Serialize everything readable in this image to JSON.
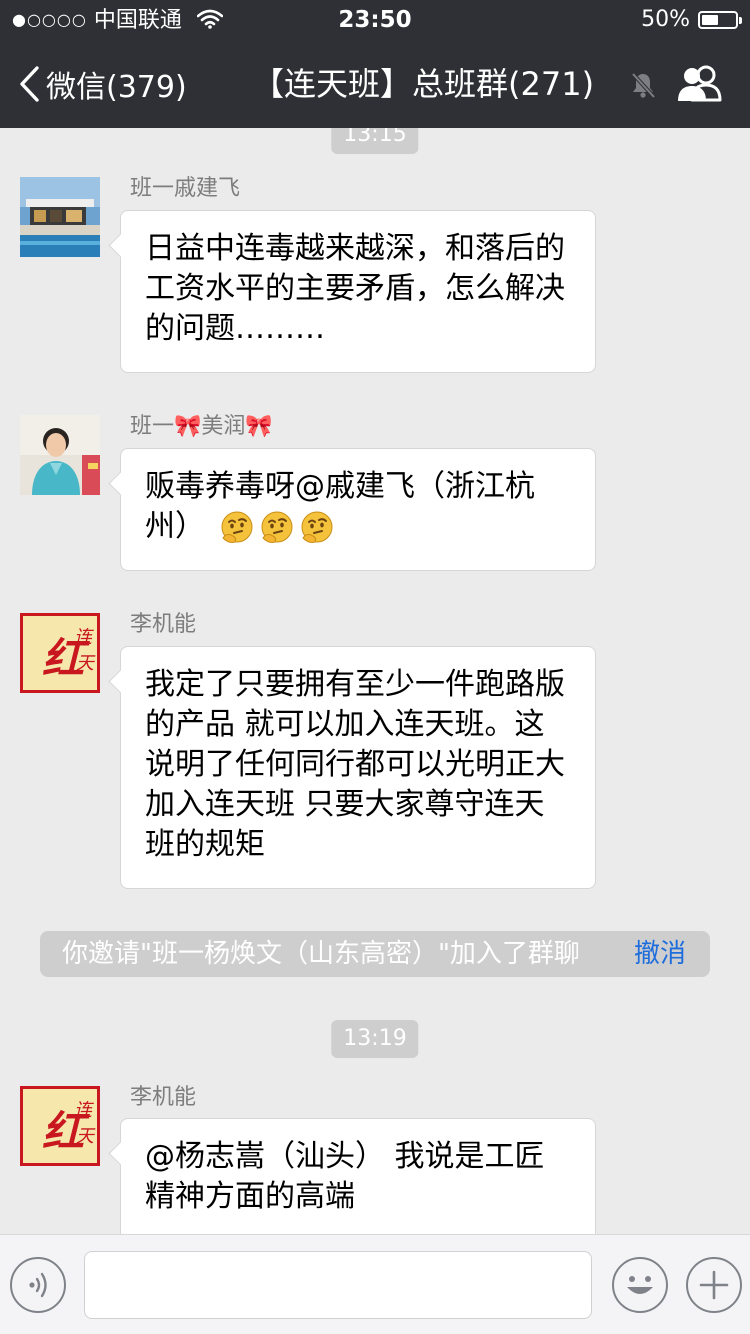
{
  "status_bar": {
    "carrier_dots": "●○○○○",
    "carrier": "中国联通",
    "time": "23:50",
    "battery": "50%",
    "battery_level": 0.5
  },
  "nav": {
    "back_label": "微信(379)",
    "title": "【连天班】总班群(271)"
  },
  "messages": [
    {
      "sender": "班一戚建飞",
      "text": "日益中连毒越来越深，和落后的工资水平的主要矛盾，怎么解决的问题………"
    },
    {
      "sender": "班一🎀美润🎀",
      "text": "贩毒养毒呀@戚建飞（浙江杭州）",
      "emoji": [
        "thinking-face",
        "thinking-face",
        "thinking-face"
      ]
    },
    {
      "sender": "李机能",
      "text": "我定了只要拥有至少一件跑路版的产品 就可以加入连天班。这说明了任何同行都可以光明正大加入连天班  只要大家尊守连天班的规矩"
    },
    {
      "sender": "李机能",
      "text": "@杨志嵩（汕头） 我说是工匠精神方面的高端"
    }
  ],
  "timestamps": [
    "13:15",
    "13:19"
  ],
  "system_message": {
    "text": "你邀请\"班一杨焕文（山东高密）\"加入了群聊",
    "action": "撤消"
  },
  "avatar_logo_text": "红连天",
  "colors": {
    "header_bg": "#2e3035",
    "chat_bg": "#ebebeb",
    "link": "#1e6ddc",
    "logo_red": "#c8171e"
  }
}
